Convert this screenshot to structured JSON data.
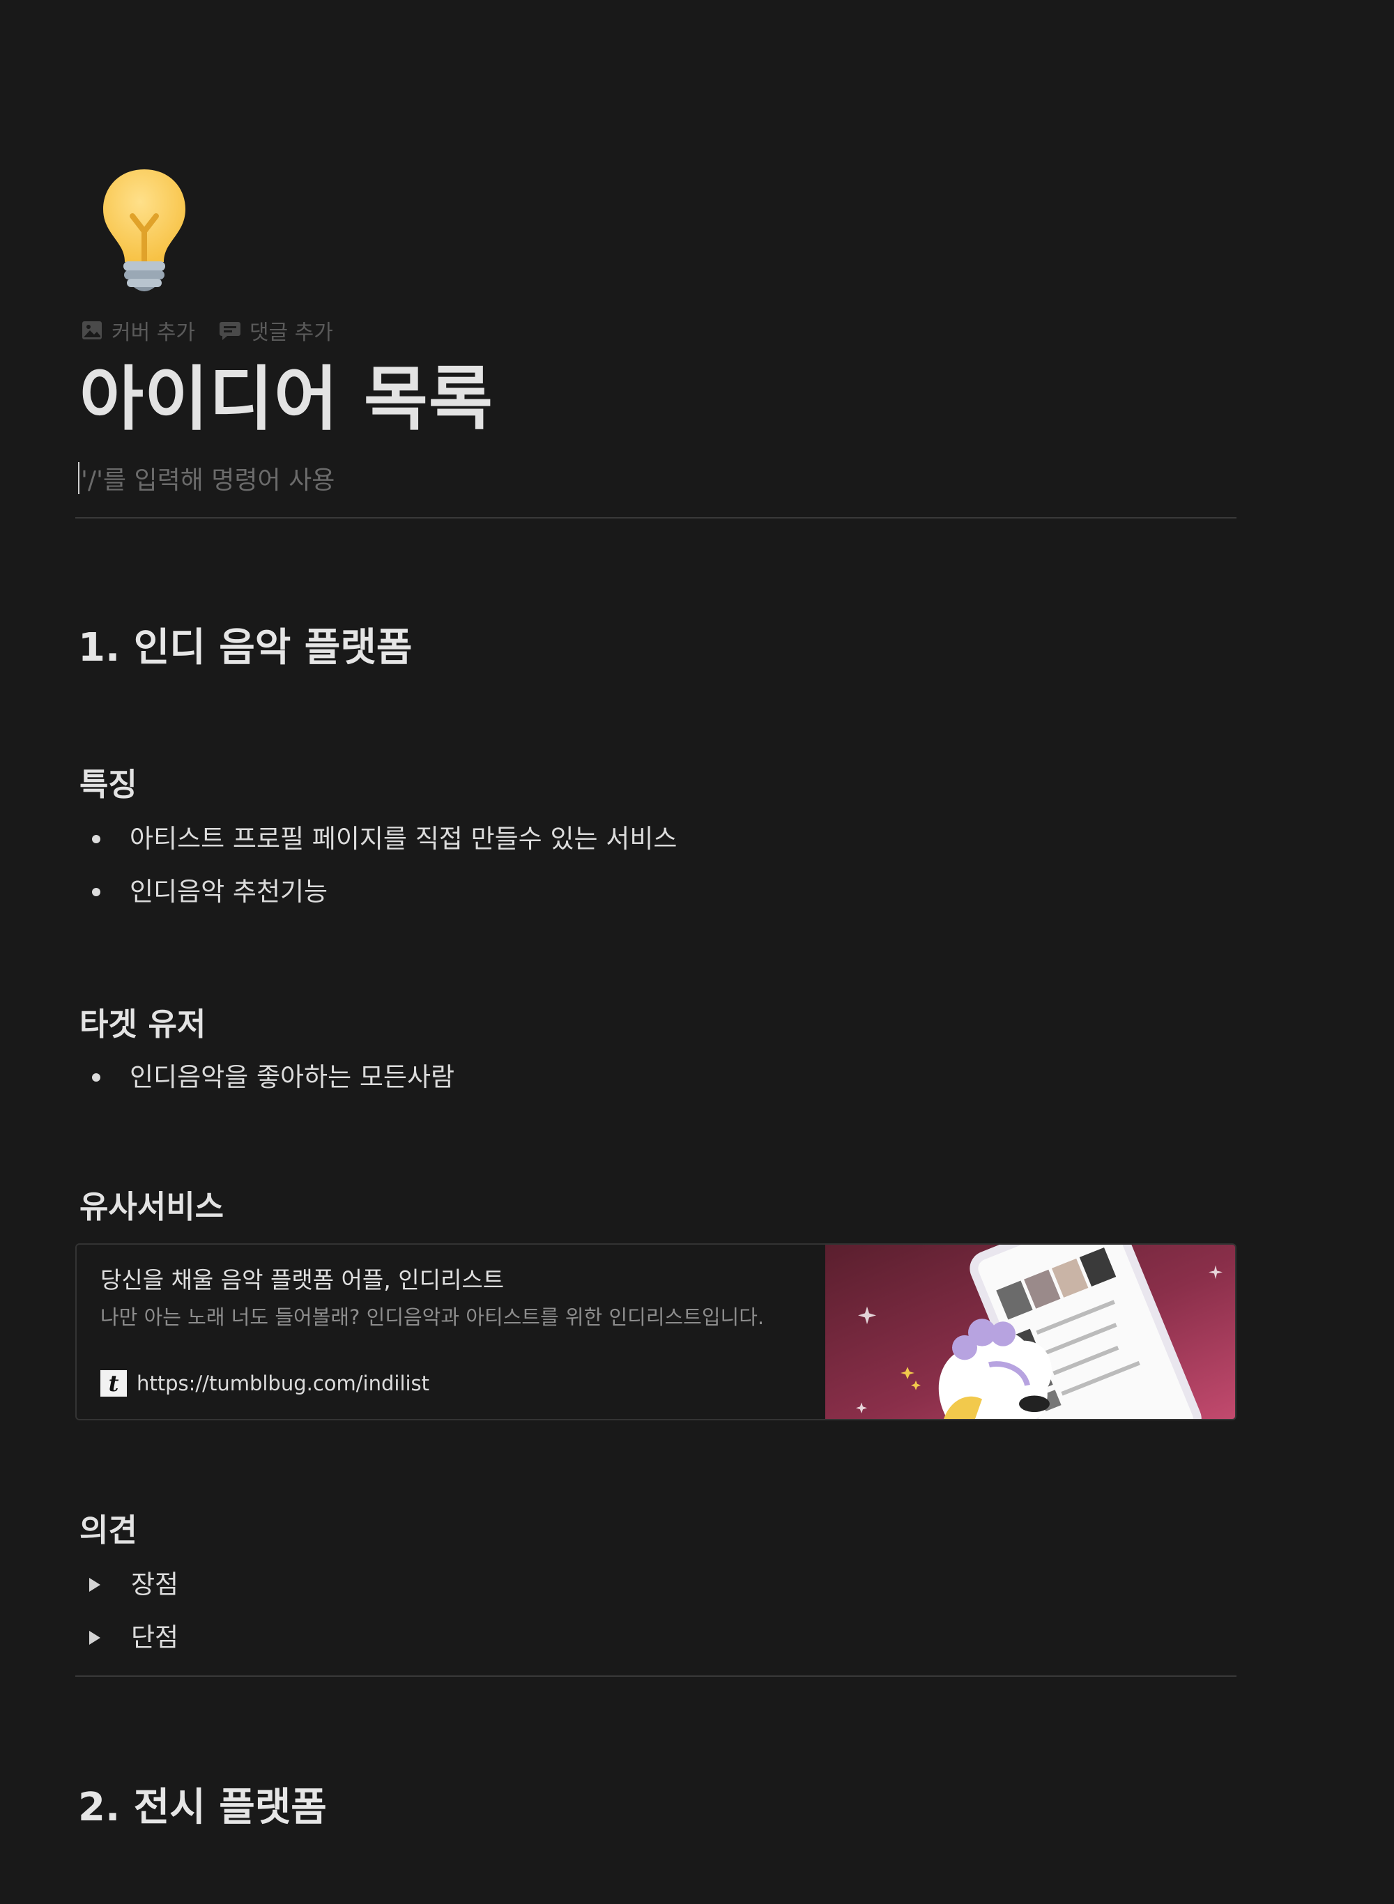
{
  "page": {
    "icon": "lightbulb-icon",
    "controls": {
      "add_cover": "커버 추가",
      "add_comment": "댓글 추가"
    },
    "title": "아이디어 목록",
    "placeholder": "'/'를 입력해 명령어 사용"
  },
  "sections": [
    {
      "heading": "1. 인디 음악 플랫폼",
      "features": {
        "heading": "특징",
        "items": [
          "아티스트 프로필 페이지를 직접 만들수 있는 서비스",
          "인디음악 추천기능"
        ]
      },
      "target": {
        "heading": "타겟 유저",
        "items": [
          "인디음악을 좋아하는 모든사람"
        ]
      },
      "similar": {
        "heading": "유사서비스",
        "bookmark": {
          "title": "당신을 채울 음악 플랫폼 어플, 인디리스트",
          "description": "나만 아는 노래 너도 들어볼래? 인디음악과 아티스트를 위한 인디리스트입니다.",
          "favicon": "t",
          "url": "https://tumblbug.com/indilist"
        }
      },
      "opinion": {
        "heading": "의견",
        "toggles": [
          "장점",
          "단점"
        ]
      }
    },
    {
      "heading": "2. 전시 플랫폼"
    }
  ],
  "colors": {
    "background": "#191919",
    "text": "#d4d4d4",
    "muted": "#5a5a5a",
    "divider": "#393939"
  }
}
